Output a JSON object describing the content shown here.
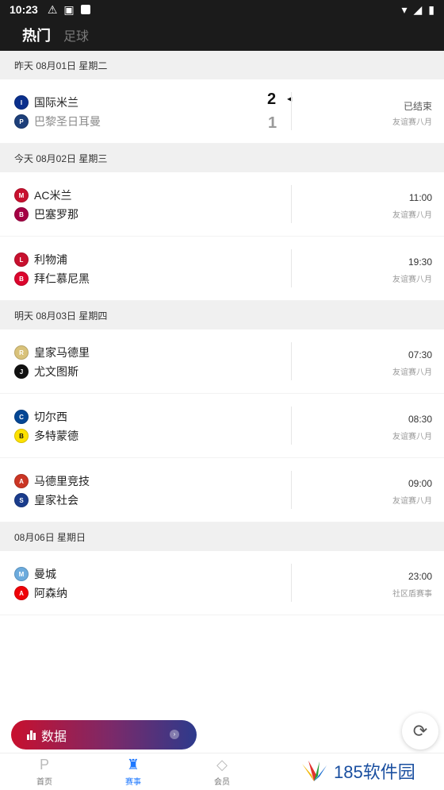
{
  "status_bar": {
    "time": "10:23"
  },
  "top_tabs": [
    {
      "label": "热门",
      "active": true
    },
    {
      "label": "足球",
      "active": false
    }
  ],
  "days": [
    {
      "header": "昨天 08月01日 星期二",
      "matches": [
        {
          "home": "国际米兰",
          "away": "巴黎圣日耳曼",
          "home_score": "2",
          "away_score": "1",
          "status": "已结束",
          "competition": "友谊赛八月",
          "home_logo_color": "#0a2f8c",
          "away_logo_color": "#1d3f7a",
          "away_dim": true
        }
      ]
    },
    {
      "header": "今天 08月02日 星期三",
      "matches": [
        {
          "home": "AC米兰",
          "away": "巴塞罗那",
          "time": "11:00",
          "competition": "友谊赛八月",
          "home_logo_color": "#c8102e",
          "away_logo_color": "#a50044"
        },
        {
          "home": "利物浦",
          "away": "拜仁慕尼黑",
          "time": "19:30",
          "competition": "友谊赛八月",
          "home_logo_color": "#c8102e",
          "away_logo_color": "#dc052d"
        }
      ]
    },
    {
      "header": "明天 08月03日 星期四",
      "matches": [
        {
          "home": "皇家马德里",
          "away": "尤文图斯",
          "time": "07:30",
          "competition": "友谊赛八月",
          "home_logo_color": "#d9c27a",
          "away_logo_color": "#111111"
        },
        {
          "home": "切尔西",
          "away": "多特蒙德",
          "time": "08:30",
          "competition": "友谊赛八月",
          "home_logo_color": "#034694",
          "away_logo_color": "#fde100"
        },
        {
          "home": "马德里竞技",
          "away": "皇家社会",
          "time": "09:00",
          "competition": "友谊赛八月",
          "home_logo_color": "#cb3524",
          "away_logo_color": "#1a3c8c"
        }
      ]
    },
    {
      "header": "08月06日 星期日",
      "matches": [
        {
          "home": "曼城",
          "away": "阿森纳",
          "time": "23:00",
          "competition": "社区盾赛事",
          "home_logo_color": "#6cabdd",
          "away_logo_color": "#ef0107"
        }
      ]
    }
  ],
  "data_button": {
    "label": "数据"
  },
  "bottom_nav": [
    {
      "label": "首页",
      "icon": "home-p-icon",
      "active": false
    },
    {
      "label": "赛事",
      "icon": "trophy-icon",
      "active": true
    },
    {
      "label": "会员",
      "icon": "diamond-icon",
      "active": false
    }
  ],
  "watermark": {
    "text": "185软件园"
  },
  "colors": {
    "accent": "#1e78ff",
    "header_bg": "#1b1b1b",
    "section_bg": "#f0f0f0"
  }
}
